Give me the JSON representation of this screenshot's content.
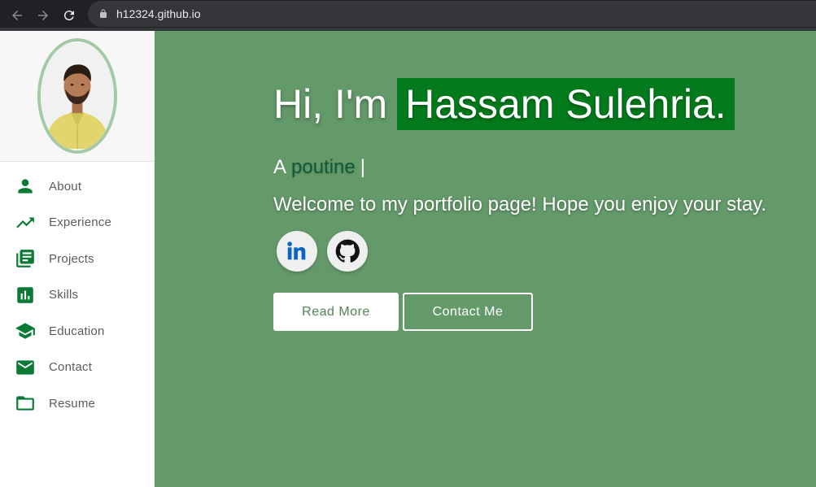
{
  "browser": {
    "url": "h12324.github.io",
    "back_icon": "arrow-left-icon",
    "forward_icon": "arrow-right-icon",
    "reload_icon": "reload-icon",
    "lock_icon": "lock-icon"
  },
  "sidebar": {
    "avatar": "profile-photo",
    "items": [
      {
        "label": "About",
        "icon": "person-icon"
      },
      {
        "label": "Experience",
        "icon": "trending-up-icon"
      },
      {
        "label": "Projects",
        "icon": "library-books-icon"
      },
      {
        "label": "Skills",
        "icon": "bar-chart-icon"
      },
      {
        "label": "Education",
        "icon": "graduation-cap-icon"
      },
      {
        "label": "Contact",
        "icon": "email-icon"
      },
      {
        "label": "Resume",
        "icon": "folder-icon"
      }
    ]
  },
  "hero": {
    "greeting_prefix": "Hi, I'm",
    "name": "Hassam Sulehria.",
    "typed_prefix": "A",
    "typed_word": "poutine",
    "cursor": "|",
    "welcome": "Welcome to my portfolio page! Hope you enjoy your stay.",
    "socials": [
      {
        "name": "linkedin",
        "icon": "linkedin-icon"
      },
      {
        "name": "github",
        "icon": "github-icon"
      }
    ],
    "read_more_label": "Read More",
    "contact_label": "Contact Me"
  },
  "colors": {
    "accent_green": "#0b7a35",
    "hero_bg": "#64996a",
    "name_highlight": "#037b1c"
  }
}
